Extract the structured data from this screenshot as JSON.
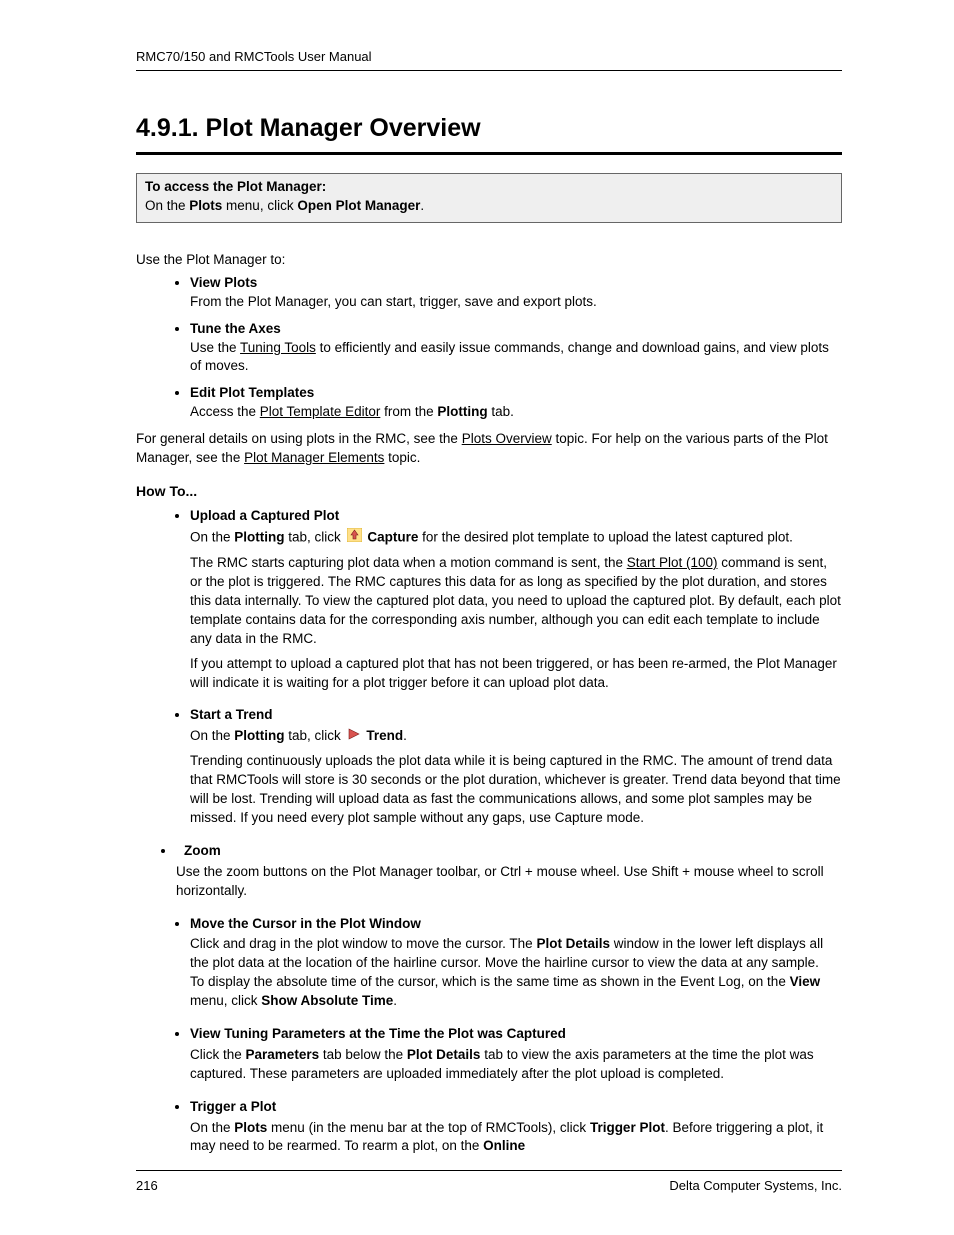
{
  "header": "RMC70/150 and RMCTools User Manual",
  "title": "4.9.1. Plot Manager Overview",
  "access_box": {
    "line1_bold": "To access the Plot Manager:",
    "line2_a": "On the ",
    "line2_b": "Plots",
    "line2_c": " menu, click ",
    "line2_d": "Open Plot Manager",
    "line2_e": "."
  },
  "intro": "Use the Plot Manager to:",
  "top_items": {
    "view_title": "View Plots",
    "view_body": "From the Plot Manager, you can start, trigger, save and export plots.",
    "tune_title": "Tune the Axes",
    "tune_a": "Use the ",
    "tune_link": "Tuning Tools",
    "tune_b": " to efficiently and easily issue commands, change and download gains, and view plots of moves.",
    "edit_title": "Edit Plot Templates",
    "edit_a": "Access the ",
    "edit_link": "Plot Template Editor",
    "edit_b": " from the ",
    "edit_c": "Plotting",
    "edit_d": " tab."
  },
  "general_a": "For general details on using plots in the RMC, see the ",
  "general_link1": "Plots Overview",
  "general_b": " topic. For help on the various parts of the Plot Manager, see the ",
  "general_link2": "Plot Manager Elements",
  "general_c": " topic.",
  "howto_heading": "How To...",
  "howto": {
    "upload_title": "Upload a Captured Plot",
    "upload_l1a": "On the ",
    "upload_l1b": "Plotting",
    "upload_l1c": " tab, click ",
    "upload_l1d": " Capture",
    "upload_l1e": " for the desired plot template to upload the latest captured plot.",
    "upload_p2a": "The RMC starts capturing plot data when a motion command is sent, the ",
    "upload_p2link": "Start Plot (100)",
    "upload_p2b": " command is sent, or the plot is triggered. The RMC captures this data for as long as specified by the plot duration, and stores this data internally. To view the captured plot data, you need to upload the captured plot. By default, each plot template contains data for the corresponding axis number, although you can edit each template to include any data in the RMC.",
    "upload_p3": "If you attempt to upload a captured plot that has not been triggered, or has been re-armed, the Plot Manager will indicate it is waiting for a plot trigger before it can upload plot data.",
    "trend_title": "Start a Trend",
    "trend_l1a": "On the ",
    "trend_l1b": "Plotting",
    "trend_l1c": " tab, click ",
    "trend_l1d": " Trend",
    "trend_l1e": ".",
    "trend_p2": "Trending continuously uploads the plot data while it is being captured in the RMC. The amount of trend data that RMCTools will store is 30 seconds or the plot duration, whichever is greater. Trend data beyond that time will be lost. Trending will upload data as fast the communications allows, and some plot samples may be missed. If you need every plot sample without any gaps, use Capture mode.",
    "zoom_title": "Zoom",
    "zoom_body": "Use the zoom buttons on the Plot Manager toolbar, or Ctrl + mouse wheel. Use Shift + mouse wheel to scroll horizontally.",
    "cursor_title": "Move the Cursor in the Plot Window",
    "cursor_a": "Click and drag in the plot window to move the cursor. The ",
    "cursor_b": "Plot Details",
    "cursor_c": " window in the lower left displays all the plot data at the location of the hairline cursor. Move the hairline cursor to view the data at any sample.",
    "cursor_d": "To display the absolute time of the cursor, which is the same time as shown in the Event Log, on the ",
    "cursor_e": "View",
    "cursor_f": " menu, click ",
    "cursor_g": "Show Absolute Time",
    "cursor_h": ".",
    "params_title": "View Tuning Parameters at the Time the Plot was Captured",
    "params_a": "Click the ",
    "params_b": "Parameters",
    "params_c": " tab below the ",
    "params_d": "Plot Details",
    "params_e": " tab to view the axis parameters at the time the plot was captured. These parameters are uploaded immediately after the plot upload is completed.",
    "trigger_title": "Trigger a Plot",
    "trigger_a": "On the ",
    "trigger_b": "Plots",
    "trigger_c": " menu (in the menu bar at the top of RMCTools), click ",
    "trigger_d": "Trigger Plot",
    "trigger_e": ". Before triggering a plot, it may need to be rearmed. To rearm a plot, on the ",
    "trigger_f": "Online"
  },
  "footer": {
    "page": "216",
    "company": "Delta Computer Systems, Inc."
  }
}
